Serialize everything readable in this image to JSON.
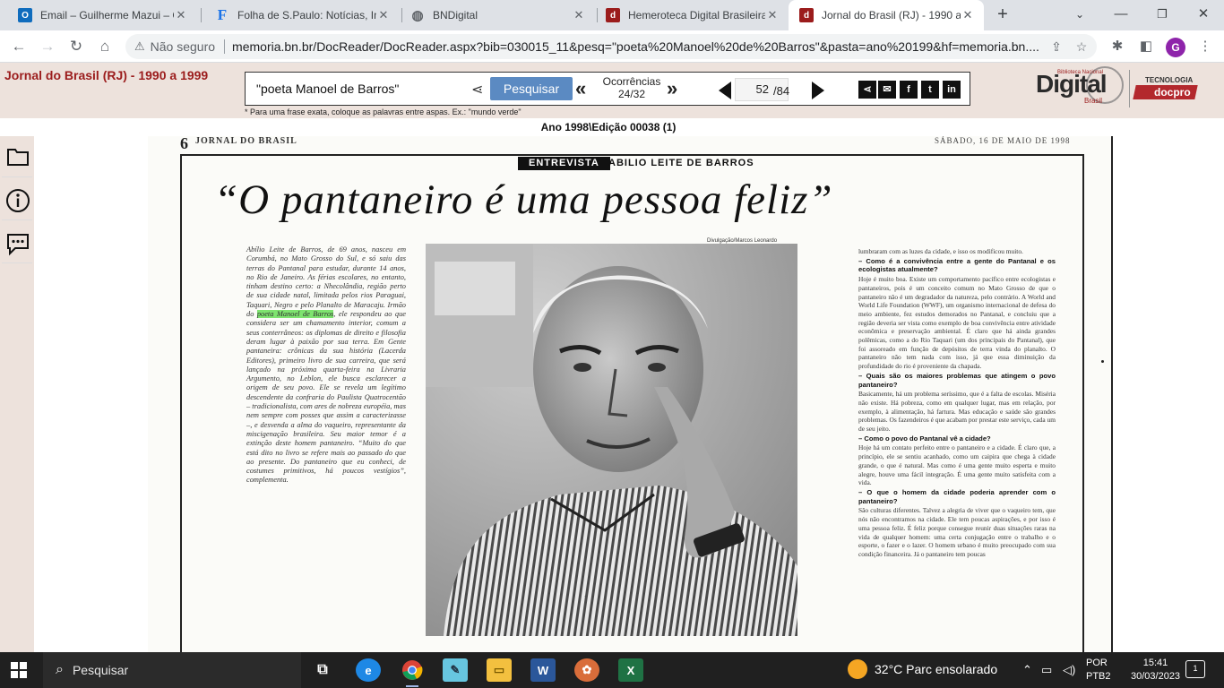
{
  "browser": {
    "tabs": [
      {
        "label": "Email – Guilherme Mazui – O",
        "icon": "outlook-icon",
        "color": "#0f6cbd",
        "glyph": "O"
      },
      {
        "label": "Folha de S.Paulo: Notícias, Im",
        "icon": "folha-icon",
        "color": "#1a73e8",
        "glyph": "F"
      },
      {
        "label": "BNDigital",
        "icon": "globe-icon",
        "color": "#5f6368",
        "glyph": "◍"
      },
      {
        "label": "Hemeroteca Digital Brasileira",
        "icon": "hemeroteca-icon",
        "color": "#9b1c1c",
        "glyph": "d"
      },
      {
        "label": "Jornal do Brasil (RJ) - 1990 a",
        "icon": "hemeroteca-icon",
        "color": "#9b1c1c",
        "glyph": "d"
      }
    ],
    "security_label": "Não seguro",
    "url": "memoria.bn.br/DocReader/DocReader.aspx?bib=030015_11&pesq=\"poeta%20Manoel%20de%20Barros\"&pasta=ano%20199&hf=memoria.bn....",
    "profile_initial": "G"
  },
  "site": {
    "title": "Jornal do Brasil (RJ) - 1990 a 1999",
    "search_value": "\"poeta Manoel de Barros\"",
    "search_button": "Pesquisar",
    "occurrences_label": "Ocorrências",
    "occurrences_value": "24/32",
    "page_current": "52",
    "page_total": "/84",
    "hint": "* Para uma frase exata, coloque as palavras entre aspas. Ex.: \"mundo verde\"",
    "edition": "Ano 1998\\Edição 00038 (1)",
    "logo": {
      "top": "Biblioteca Nacional",
      "main": "Digital",
      "bottom": "Brasil",
      "tec": "TECNOLOGIA",
      "docpro": "docpro"
    }
  },
  "newspaper": {
    "page_number": "6",
    "paper_name": "JORNAL DO BRASIL",
    "date": "SÁBADO, 16 DE MAIO DE 1998",
    "kicker": "ENTREVISTA",
    "interviewee": "ABILIO LEITE DE BARROS",
    "headline": "“O pantaneiro é uma pessoa feliz”",
    "photo_credit": "Divulgação/Marcos Leonardo",
    "intro_part1": "Abílio Leite de Barros, de 69 anos, nasceu em Corumbá, no Mato Grosso do Sul, e só saiu das terras do Pantanal para estudar, durante 14 anos, no Rio de Janeiro. As férias escolares, no entanto, tinham destino certo: a Nhecolândia, região perto de sua cidade natal, limitada pelos rios Paraguai, Taquari, Negro e pelo Planalto de Maracaju. Irmão do",
    "intro_highlight": "poeta Manoel de Barros",
    "intro_part2": ", ele respondeu ao que considera ser um chamamento interior, comum a seus conterrâneos: os diplomas de direito e filosofia deram lugar à paixão por sua terra. Em Gente pantaneira: crônicas da sua história (Lacerda Editores), primeiro livro de sua carreira, que será lançado na próxima quarta-feira na Livraria Argumento, no Leblon, ele busca esclarecer a origem de seu povo. Ele se revela um legítimo descendente da confraria do Paulista Quatrocentão – tradicionalista, com ares de nobreza européia, mas nem sempre com posses que assim a caracterizasse –, e desvenda a alma do vaqueiro, representante da miscigenação brasileira. Seu maior temor é a extinção deste homem pantaneiro. “Muito do que está dito no livro se refere mais ao passado do que ao presente. Do pantaneiro que eu conheci, de costumes primitivos, há poucos vestígios”, complementa.",
    "right_col": [
      {
        "type": "a",
        "text": "lumbraram com as luzes da cidade, e isso os modificou muito."
      },
      {
        "type": "q",
        "text": "– Como é a convivência entre a gente do Pantanal e os ecologistas atualmente?"
      },
      {
        "type": "a",
        "text": "Hoje é muito boa. Existe um comportamento pacífico entre ecologistas e pantaneiros, pois é um conceito comum no Mato Grosso de que o pantaneiro não é um degradador da natureza, pelo contrário. A World and World Life Foundation (WWF), um organismo internacional de defesa do meio ambiente, fez estudos demorados no Pantanal, e concluiu que a região deveria ser vista como exemplo de boa convivência entre atividade econômica e preservação ambiental. É claro que há ainda grandes polêmicas, como a do Rio Taquari (um dos principais do Pantanal), que foi assoreado em função de depósitos de terra vinda do planalto. O pantaneiro não tem nada com isso, já que essa diminuição da profundidade do rio é proveniente da chapada."
      },
      {
        "type": "q",
        "text": "– Quais são os maiores problemas que atingem o povo pantaneiro?"
      },
      {
        "type": "a",
        "text": "Basicamente, há um problema seríssimo, que é a falta de escolas. Miséria não existe. Há pobreza, como em qualquer lugar, mas em relação, por exemplo, à alimentação, há fartura. Mas educação e saúde são grandes problemas. Os fazendeiros é que acabam por prestar este serviço, cada um de seu jeito."
      },
      {
        "type": "q",
        "text": "– Como o povo do Pantanal vê a cidade?"
      },
      {
        "type": "a",
        "text": "Hoje há um contato perfeito entre o pantaneiro e a cidade. É claro que, a princípio, ele se sentiu acanhado, como um caipira que chega à cidade grande, o que é natural. Mas como é uma gente muito esperta e muito alegre, houve uma fácil integração. É uma gente muito satisfeita com a vida."
      },
      {
        "type": "q",
        "text": "– O que o homem da cidade poderia aprender com o pantaneiro?"
      },
      {
        "type": "a",
        "text": "São culturas diferentes. Talvez a alegria de viver que o vaqueiro tem, que nós não encontramos na cidade. Ele tem poucas aspirações, e por isso é uma pessoa feliz. É feliz porque consegue reunir duas situações raras na vida de qualquer homem: uma certa conjugação entre o trabalho e o esporte, o fazer e o lazer. O homem urbano é muito preocupado com sua condição financeira. Já o pantaneiro tem poucas"
      }
    ]
  },
  "taskbar": {
    "search_placeholder": "Pesquisar",
    "weather": "32°C  Parc ensolarado",
    "lang_line1": "POR",
    "lang_line2": "PTB2",
    "time": "15:41",
    "date": "30/03/2023",
    "notif_count": "1"
  }
}
